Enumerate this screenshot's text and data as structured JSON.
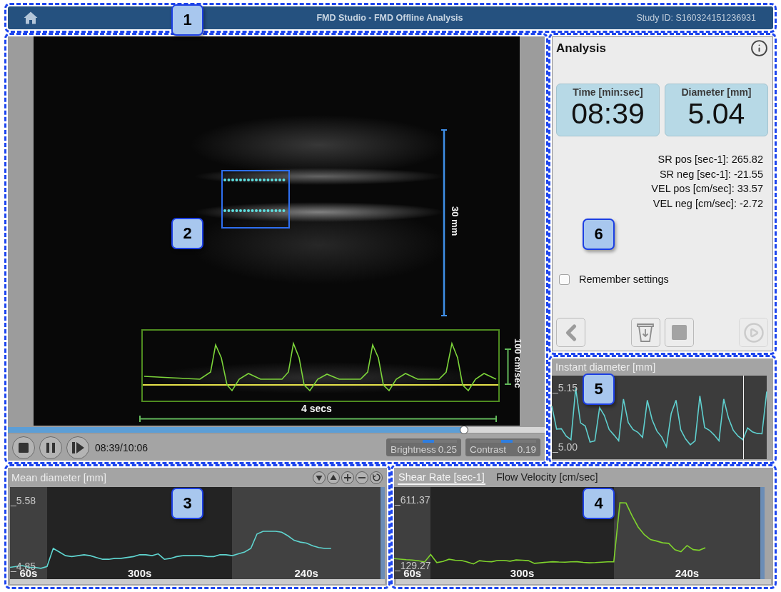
{
  "top_bar": {
    "callout": "1",
    "title": "FMD Studio - FMD Offline Analysis",
    "study_id": "Study ID: S160324151236931"
  },
  "video_panel": {
    "callout": "2",
    "depth_scale": "30 mm",
    "velocity_scale": "100 cm/sec",
    "time_scale": "4 secs",
    "progress": {
      "level": 0.85
    },
    "controls": [
      {
        "kind": "stop"
      },
      {
        "kind": "pause"
      },
      {
        "kind": "step"
      }
    ],
    "time": "08:39/10:06",
    "adjustments": [
      {
        "label": "Brightness",
        "value": "0.25",
        "level": 0.57
      },
      {
        "label": "Contrast",
        "value": "0.19",
        "level": 0.56
      }
    ]
  },
  "analysis_panel": {
    "callout": "6",
    "title": "Analysis",
    "cards": [
      {
        "label": "Time [min:sec]",
        "value": "08:39"
      },
      {
        "label": "Diameter [mm]",
        "value": "5.04"
      }
    ],
    "stats": [
      "SR pos [sec-1]: 265.82",
      "SR neg [sec-1]: -21.55",
      "VEL pos [cm/sec]: 33.57",
      "VEL neg [cm/sec]: -2.72"
    ],
    "remember_settings": {
      "label": "Remember settings",
      "checked": false
    },
    "buttons": [
      {
        "kind": "back",
        "disabled": false
      },
      {
        "kind": "bin",
        "disabled": false
      },
      {
        "kind": "stop",
        "disabled": false
      },
      {
        "kind": "play",
        "disabled": true
      }
    ]
  },
  "instant_diameter_panel": {
    "callout": "5",
    "chart_data": {
      "type": "line",
      "title": "Instant diameter [mm]",
      "series": [
        {
          "color": "#5fd0cf",
          "values": [
            5.104,
            5.045,
            5.046,
            5.027,
            5.018,
            5.15,
            5.061,
            5.053,
            5.012,
            5.015,
            5.1,
            5.08,
            5.044,
            5.03,
            5.015,
            5.122,
            5.062,
            5.044,
            5.037,
            5.024,
            5.119,
            5.069,
            5.04,
            5.025,
            5.0,
            5.085,
            5.119,
            5.043,
            5.02,
            5.005,
            5.015,
            5.13,
            5.049,
            5.042,
            5.03,
            5.015,
            5.122,
            5.073,
            5.042,
            5.027,
            5.018,
            5.048,
            5.038,
            5.034,
            5.033,
            5.141
          ]
        }
      ],
      "ylim": [
        4.968,
        5.182
      ],
      "yticks": [
        {
          "value": 5.15,
          "label": "_5.15"
        },
        {
          "value": 5.0,
          "label": "_5.00"
        }
      ]
    }
  },
  "mean_diameter_panel": {
    "callout": "3",
    "tools": [
      {
        "kind": "down"
      },
      {
        "kind": "up"
      },
      {
        "kind": "plus"
      },
      {
        "kind": "minus"
      },
      {
        "kind": "reset"
      }
    ],
    "phases": [
      {
        "label": "60s",
        "color": "#404040"
      },
      {
        "label": "300s",
        "color": "#232323"
      },
      {
        "label": "240s",
        "color": "#414141"
      }
    ],
    "chart_data": {
      "type": "line",
      "title": "Mean diameter [mm]",
      "categories": [
        null,
        null,
        null,
        null,
        null,
        null,
        null,
        null,
        null,
        null,
        null,
        null,
        null,
        null,
        null,
        null,
        null,
        null,
        null,
        null,
        null,
        null,
        null,
        null,
        null,
        null,
        null,
        null,
        null,
        null,
        null,
        null,
        null,
        null,
        null,
        null,
        null,
        null,
        null,
        null,
        null,
        null,
        null,
        null,
        null,
        null,
        null,
        null,
        null,
        null,
        null,
        null,
        null,
        null,
        null,
        null,
        null,
        null,
        null,
        null,
        null
      ],
      "series": [
        {
          "color": "#5fd5d0",
          "values": [
            4.84,
            4.85,
            4.86,
            4.84,
            4.84,
            4.83,
            4.85,
            5.05,
            5.01,
            4.97,
            4.96,
            4.97,
            4.98,
            4.97,
            4.95,
            4.93,
            4.93,
            4.94,
            4.94,
            4.95,
            4.96,
            4.98,
            4.98,
            4.97,
            4.99,
            4.93,
            4.94,
            4.96,
            4.97,
            4.97,
            4.97,
            4.97,
            4.96,
            4.96,
            4.98,
            4.98,
            4.97,
            4.99,
            5.01,
            5.05,
            5.21,
            5.24,
            5.24,
            5.24,
            5.23,
            5.19,
            5.14,
            5.12,
            5.11,
            5.08,
            5.06,
            5.05,
            5.05,
            null,
            null,
            null,
            null,
            null,
            null,
            null,
            null
          ]
        }
      ],
      "ylim": [
        4.71,
        5.73
      ],
      "yticks": [
        {
          "value": 5.58,
          "label": "_5.58"
        },
        {
          "value": 4.85,
          "label": "_4.85"
        }
      ]
    }
  },
  "velocity_panel": {
    "callout": "4",
    "tabs": [
      {
        "label": "Shear Rate [sec-1]",
        "selected": true
      },
      {
        "label": "Flow Velocity [cm/sec]",
        "selected": false
      }
    ],
    "phases": [
      {
        "label": "60s",
        "color": "#3f3f3f"
      },
      {
        "label": "300s",
        "color": "#242424"
      },
      {
        "label": "240s",
        "color": "#404040"
      }
    ],
    "chart_data": {
      "type": "line",
      "categories": [
        null,
        null,
        null,
        null,
        null,
        null,
        null,
        null,
        null,
        null,
        null,
        null,
        null,
        null,
        null,
        null,
        null,
        null,
        null,
        null,
        null,
        null,
        null,
        null,
        null,
        null,
        null,
        null,
        null,
        null,
        null,
        null,
        null,
        null,
        null,
        null,
        null,
        null,
        null,
        null,
        null,
        null,
        null,
        null,
        null,
        null,
        null,
        null,
        null,
        null,
        null,
        null,
        null,
        null,
        null,
        null,
        null,
        null,
        null,
        null,
        null
      ],
      "series": [
        {
          "color": "#7fd42c",
          "values": [
            180,
            176,
            172,
            169,
            164,
            155,
            210,
            151,
            159,
            175,
            168,
            167,
            155,
            141,
            165,
            159,
            157,
            167,
            167,
            161,
            170,
            168,
            165,
            145,
            149,
            154,
            157,
            155,
            154,
            156,
            157,
            152,
            149,
            151,
            154,
            156,
            157,
            590,
            589,
            494,
            411,
            356,
            320,
            309,
            296,
            292,
            245,
            231,
            276,
            246,
            241,
            260,
            null,
            null,
            null,
            null,
            null,
            null,
            null,
            null,
            null
          ]
        }
      ],
      "ylim": [
        29,
        706
      ],
      "yticks": [
        {
          "value": 611.37,
          "label": "_611.37"
        },
        {
          "value": 129.27,
          "label": "_129.27"
        }
      ]
    }
  }
}
